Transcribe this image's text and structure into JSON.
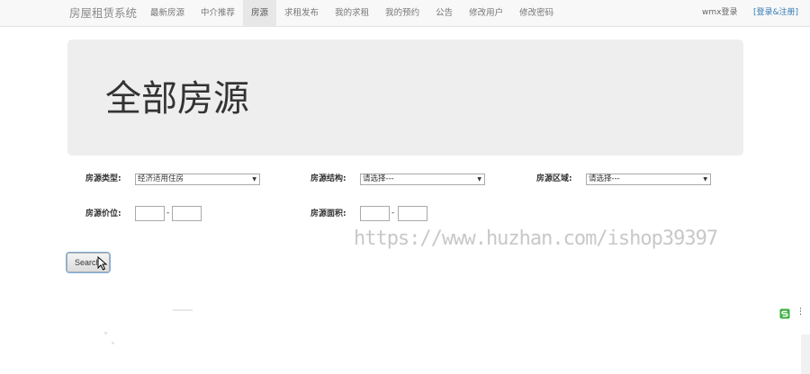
{
  "navbar": {
    "brand": "房屋租赁系统",
    "items": [
      {
        "label": "最新房源",
        "active": false
      },
      {
        "label": "中介推荐",
        "active": false
      },
      {
        "label": "房源",
        "active": true
      },
      {
        "label": "求租发布",
        "active": false
      },
      {
        "label": "我的求租",
        "active": false
      },
      {
        "label": "我的预约",
        "active": false
      },
      {
        "label": "公告",
        "active": false
      },
      {
        "label": "修改用户",
        "active": false
      },
      {
        "label": "修改密码",
        "active": false
      }
    ],
    "user": "wmx登录",
    "login": "[登录&注册]"
  },
  "jumbotron": {
    "title": "全部房源"
  },
  "filters": {
    "type_label": "房源类型:",
    "type_value": "经济适用住房",
    "structure_label": "房源结构:",
    "structure_value": "请选择---",
    "area_label": "房源区域:",
    "area_value": "请选择---",
    "price_label": "房源价位:",
    "price_sep": "-",
    "size_label": "房源面积:",
    "size_sep": "-"
  },
  "search_button": "Search",
  "watermark": "https://www.huzhan.com/ishop39397",
  "colors": {
    "nav_bg": "#f8f8f8",
    "jumbotron_bg": "#eeeeee",
    "link": "#337ab7",
    "active_nav": "#e7e7e7"
  }
}
